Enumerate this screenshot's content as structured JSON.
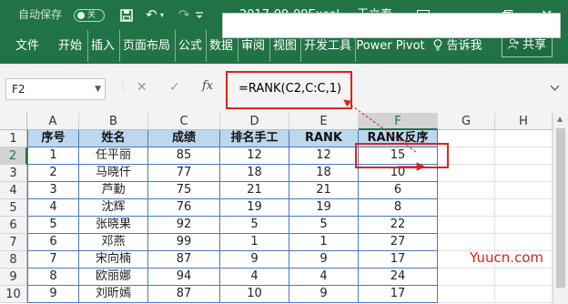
{
  "titlebar": {
    "autosave": "自动保存",
    "toggle": "关",
    "filename": "2017-09-09Excel...",
    "user": "王立春"
  },
  "ribbon": {
    "tabs": [
      "文件",
      "开始",
      "插入",
      "页面布局",
      "公式",
      "数据",
      "审阅",
      "视图",
      "开发工具",
      "Power Pivot"
    ],
    "tell_me": "告诉我",
    "share": "共享"
  },
  "formula_bar": {
    "name_box": "F2",
    "cancel": "✕",
    "enter": "✓",
    "fx": "fx",
    "formula": "=RANK(C2,C:C,1)"
  },
  "columns": [
    "A",
    "B",
    "C",
    "D",
    "E",
    "F",
    "G",
    "H"
  ],
  "rows": [
    "1",
    "2",
    "3",
    "4",
    "5",
    "6",
    "7",
    "8",
    "9",
    "10"
  ],
  "table": {
    "headers": [
      "序号",
      "姓名",
      "成绩",
      "排名手工",
      "RANK",
      "RANK反序"
    ],
    "data": [
      [
        "1",
        "任平丽",
        "85",
        "12",
        "12",
        "15"
      ],
      [
        "2",
        "马晓仟",
        "77",
        "18",
        "18",
        "10"
      ],
      [
        "3",
        "芦勤",
        "75",
        "21",
        "21",
        "6"
      ],
      [
        "4",
        "沈辉",
        "76",
        "19",
        "19",
        "8"
      ],
      [
        "5",
        "张晓果",
        "92",
        "5",
        "5",
        "22"
      ],
      [
        "6",
        "邓燕",
        "99",
        "1",
        "1",
        "27"
      ],
      [
        "7",
        "宋向楠",
        "87",
        "9",
        "9",
        "17"
      ],
      [
        "8",
        "欧丽娜",
        "94",
        "4",
        "4",
        "24"
      ],
      [
        "9",
        "刘昕嫣",
        "87",
        "10",
        "9",
        "17"
      ],
      [
        "",
        "",
        "",
        "",
        "",
        ""
      ]
    ]
  },
  "selected_cell": "F2",
  "watermark": "Yuucn.com",
  "colors": {
    "excel_green": "#217346",
    "table_header": "#bdd7ee",
    "annotation_red": "#d9251d"
  }
}
